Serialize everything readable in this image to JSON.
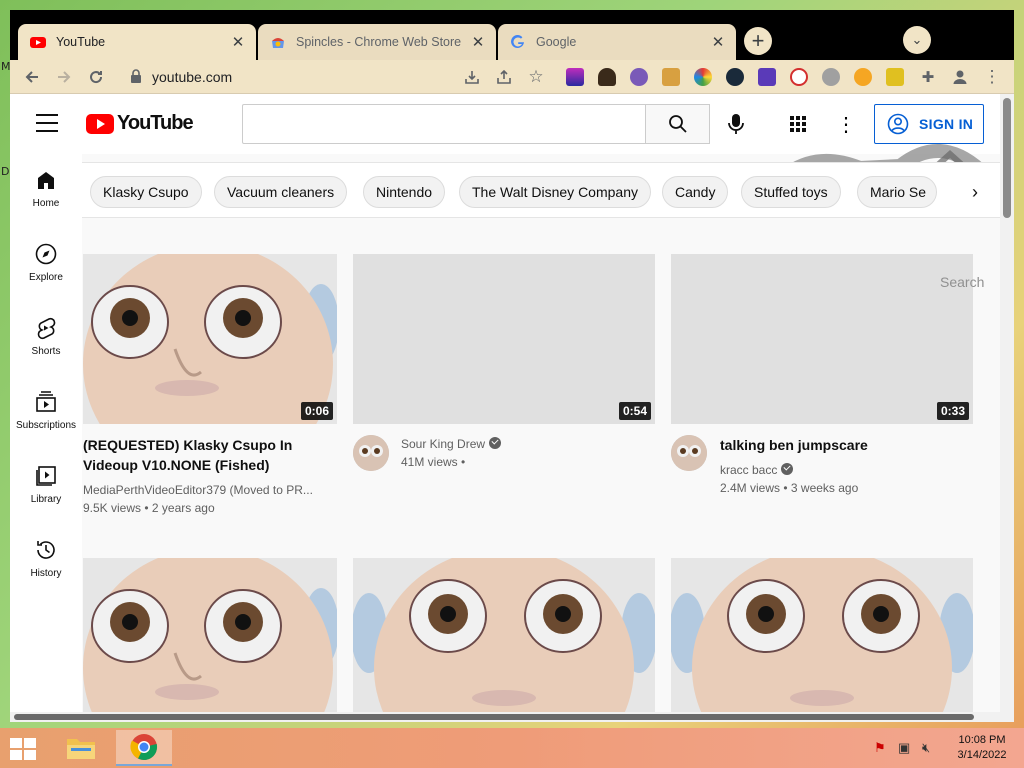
{
  "browser": {
    "tabs": [
      {
        "title": "YouTube",
        "active": true,
        "icon": "youtube-icon"
      },
      {
        "title": "Spincles - Chrome Web Store",
        "active": false,
        "icon": "chrome-web-store-icon"
      },
      {
        "title": "Google",
        "active": false,
        "icon": "google-icon"
      }
    ],
    "new_tab_label": "+",
    "url": "youtube.com"
  },
  "youtube": {
    "logo_text": "YouTube",
    "search_placeholder": "",
    "sign_in_label": "SIGN IN",
    "sidebar": [
      {
        "label": "Home",
        "icon": "home-icon"
      },
      {
        "label": "Explore",
        "icon": "compass-icon"
      },
      {
        "label": "Shorts",
        "icon": "shorts-icon"
      },
      {
        "label": "Subscriptions",
        "icon": "subscriptions-icon"
      },
      {
        "label": "Library",
        "icon": "library-icon"
      },
      {
        "label": "History",
        "icon": "history-icon"
      }
    ],
    "chips": [
      "Klasky Csupo",
      "Vacuum cleaners",
      "Nintendo",
      "The Walt Disney Company",
      "Candy",
      "Stuffed toys",
      "Mario Se"
    ],
    "ghost_search": "Search",
    "videos": [
      {
        "title_line1": "(REQUESTED) Klasky Csupo In",
        "title_line2": "Videoup V10.NONE (Fished)",
        "channel": "MediaPerthVideoEditor379 (Moved to PR...",
        "views": "9.5K views",
        "age": "2 years ago",
        "duration": "0:06"
      },
      {
        "title_line1": "",
        "title_line2": "",
        "channel": "Sour King Drew",
        "views": "41M views",
        "age": "",
        "duration": "0:54",
        "verified": true
      },
      {
        "title_line1": "talking ben jumpscare",
        "title_line2": "",
        "channel": "kracc bacc",
        "views": "2.4M views",
        "age": "3 weeks ago",
        "duration": "0:33",
        "verified": true
      }
    ]
  },
  "taskbar": {
    "time": "10:08 PM",
    "date": "3/14/2022"
  },
  "colors": {
    "youtube_red": "#ff0000",
    "sign_in_blue": "#065fd4",
    "tab_bg": "#f1e4c6"
  }
}
